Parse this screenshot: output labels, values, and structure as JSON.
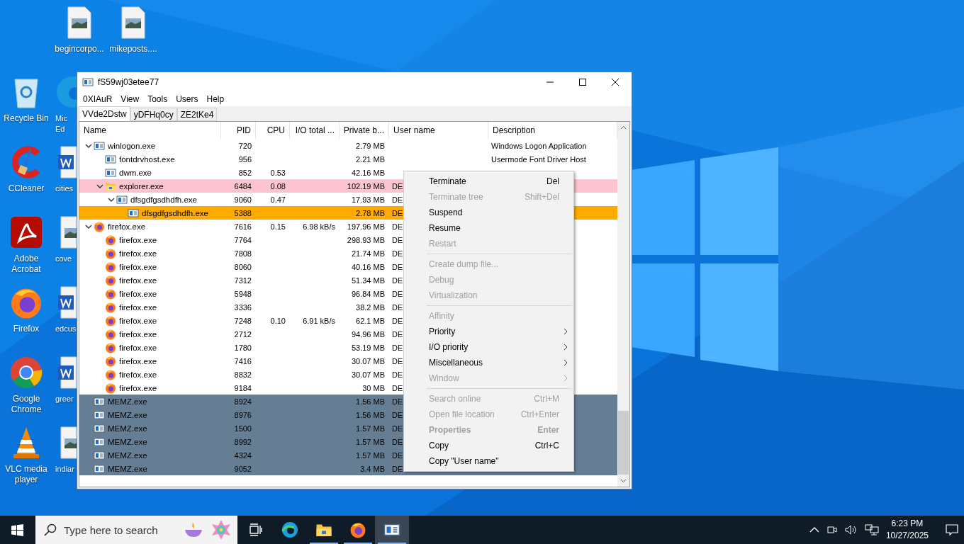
{
  "desktop": {
    "top_row": [
      {
        "label": "begincorpo...",
        "kind": "image-file"
      },
      {
        "label": "mikeposts....",
        "kind": "image-file"
      }
    ],
    "column_1": [
      {
        "label": "Recycle Bin",
        "kind": "recycle-bin"
      },
      {
        "label": "CCleaner",
        "kind": "ccleaner"
      },
      {
        "label": "Adobe Acrobat",
        "kind": "acrobat"
      },
      {
        "label": "Firefox",
        "kind": "firefox"
      },
      {
        "label": "Google Chrome",
        "kind": "chrome"
      },
      {
        "label": "VLC media player",
        "kind": "vlc"
      }
    ],
    "column_2": [
      {
        "label": "Mic Ed",
        "kind": "edge"
      },
      {
        "label": "cities",
        "kind": "word"
      },
      {
        "label": "cove",
        "kind": "image-file"
      },
      {
        "label": "edcus",
        "kind": "word"
      },
      {
        "label": "greer",
        "kind": "word"
      },
      {
        "label": "indiar",
        "kind": "image-file"
      }
    ]
  },
  "window": {
    "title": "fS59wj03etee77",
    "menu": [
      "0XIAuR",
      "View",
      "Tools",
      "Users",
      "Help"
    ],
    "tabs": [
      {
        "label": "VVde2Dstw",
        "selected": true
      },
      {
        "label": "yDFHq0cy",
        "selected": false
      },
      {
        "label": "ZE2tKe4",
        "selected": false
      }
    ],
    "columns": [
      "Name",
      "PID",
      "CPU",
      "I/O total ...",
      "Private b...",
      "User name",
      "Description"
    ],
    "processes": [
      {
        "name": "winlogon.exe",
        "pid": "720",
        "private": "2.79 MB",
        "description": "Windows Logon Application",
        "kind": "app",
        "expanded": true,
        "children": [
          {
            "name": "fontdrvhost.exe",
            "pid": "956",
            "private": "2.21 MB",
            "description": "Usermode Font Driver Host",
            "kind": "app"
          },
          {
            "name": "dwm.exe",
            "pid": "852",
            "cpu": "0.53",
            "private": "42.16 MB",
            "kind": "app"
          },
          {
            "name": "explorer.exe",
            "pid": "6484",
            "cpu": "0.08",
            "private": "102.19 MB",
            "user": "DE",
            "kind": "folder",
            "color": "#fcc4ce",
            "expanded": true,
            "children": [
              {
                "name": "dfsgdfgsdhdfh.exe",
                "pid": "9060",
                "cpu": "0.47",
                "private": "17.93 MB",
                "user": "DE",
                "kind": "app",
                "expanded": true,
                "children": [
                  {
                    "name": "dfsgdfgsdhdfh.exe",
                    "pid": "5388",
                    "private": "2.78 MB",
                    "user": "DE",
                    "kind": "app",
                    "color": "#ffaa00"
                  }
                ]
              }
            ]
          }
        ]
      },
      {
        "name": "firefox.exe",
        "pid": "7616",
        "cpu": "0.15",
        "io": "6.98 kB/s",
        "private": "197.96 MB",
        "user": "DE",
        "kind": "firefox",
        "expanded": true,
        "children": [
          {
            "name": "firefox.exe",
            "pid": "7764",
            "private": "298.93 MB",
            "user": "DE",
            "kind": "firefox"
          },
          {
            "name": "firefox.exe",
            "pid": "7808",
            "private": "21.74 MB",
            "user": "DE",
            "kind": "firefox"
          },
          {
            "name": "firefox.exe",
            "pid": "8060",
            "private": "40.16 MB",
            "user": "DE",
            "kind": "firefox"
          },
          {
            "name": "firefox.exe",
            "pid": "7312",
            "private": "51.34 MB",
            "user": "DE",
            "kind": "firefox"
          },
          {
            "name": "firefox.exe",
            "pid": "5948",
            "private": "96.84 MB",
            "user": "DE",
            "kind": "firefox"
          },
          {
            "name": "firefox.exe",
            "pid": "3336",
            "private": "38.2 MB",
            "user": "DE",
            "kind": "firefox"
          },
          {
            "name": "firefox.exe",
            "pid": "7248",
            "cpu": "0.10",
            "io": "6.91 kB/s",
            "private": "62.1 MB",
            "user": "DE",
            "kind": "firefox"
          },
          {
            "name": "firefox.exe",
            "pid": "2712",
            "private": "94.96 MB",
            "user": "DE",
            "kind": "firefox"
          },
          {
            "name": "firefox.exe",
            "pid": "1780",
            "private": "53.19 MB",
            "user": "DE",
            "kind": "firefox"
          },
          {
            "name": "firefox.exe",
            "pid": "7416",
            "private": "30.07 MB",
            "user": "DE",
            "kind": "firefox"
          },
          {
            "name": "firefox.exe",
            "pid": "8832",
            "private": "30.07 MB",
            "user": "DE",
            "kind": "firefox"
          },
          {
            "name": "firefox.exe",
            "pid": "9184",
            "private": "30 MB",
            "user": "DE",
            "kind": "firefox"
          }
        ]
      },
      {
        "name": "MEMZ.exe",
        "pid": "8924",
        "private": "1.56 MB",
        "user": "DE",
        "kind": "app",
        "color": "#667e94"
      },
      {
        "name": "MEMZ.exe",
        "pid": "8976",
        "private": "1.56 MB",
        "user": "DE",
        "kind": "app",
        "color": "#667e94"
      },
      {
        "name": "MEMZ.exe",
        "pid": "1500",
        "private": "1.57 MB",
        "user": "DE",
        "kind": "app",
        "color": "#667e94"
      },
      {
        "name": "MEMZ.exe",
        "pid": "8992",
        "private": "1.57 MB",
        "user": "DE",
        "kind": "app",
        "color": "#667e94"
      },
      {
        "name": "MEMZ.exe",
        "pid": "4324",
        "private": "1.57 MB",
        "user": "DE",
        "kind": "app",
        "color": "#667e94"
      },
      {
        "name": "MEMZ.exe",
        "pid": "9052",
        "private": "3.4 MB",
        "user": "DE",
        "kind": "app",
        "color": "#667e94"
      }
    ]
  },
  "context_menu": [
    {
      "kind": "item",
      "label": "Terminate",
      "shortcut": "Del",
      "disabled": false
    },
    {
      "kind": "item",
      "label": "Terminate tree",
      "shortcut": "Shift+Del",
      "disabled": true
    },
    {
      "kind": "item",
      "label": "Suspend",
      "disabled": false
    },
    {
      "kind": "item",
      "label": "Resume",
      "disabled": false
    },
    {
      "kind": "item",
      "label": "Restart",
      "disabled": true
    },
    {
      "kind": "separator"
    },
    {
      "kind": "item",
      "label": "Create dump file...",
      "disabled": true
    },
    {
      "kind": "item",
      "label": "Debug",
      "disabled": true
    },
    {
      "kind": "item",
      "label": "Virtualization",
      "disabled": true
    },
    {
      "kind": "separator"
    },
    {
      "kind": "item",
      "label": "Affinity",
      "disabled": true
    },
    {
      "kind": "item",
      "label": "Priority",
      "disabled": false,
      "submenu": true
    },
    {
      "kind": "item",
      "label": "I/O priority",
      "disabled": false,
      "submenu": true
    },
    {
      "kind": "item",
      "label": "Miscellaneous",
      "disabled": false,
      "submenu": true
    },
    {
      "kind": "item",
      "label": "Window",
      "disabled": true,
      "submenu": true
    },
    {
      "kind": "separator"
    },
    {
      "kind": "item",
      "label": "Search online",
      "shortcut": "Ctrl+M",
      "disabled": true
    },
    {
      "kind": "item",
      "label": "Open file location",
      "shortcut": "Ctrl+Enter",
      "disabled": true
    },
    {
      "kind": "item",
      "label": "Properties",
      "shortcut": "Enter",
      "disabled": true,
      "bold": true
    },
    {
      "kind": "item",
      "label": "Copy",
      "shortcut": "Ctrl+C",
      "disabled": false
    },
    {
      "kind": "item",
      "label": "Copy \"User name\"",
      "disabled": false
    }
  ],
  "taskbar": {
    "search_placeholder": "Type here to search",
    "apps": [
      {
        "kind": "edge",
        "running": false,
        "active": false
      },
      {
        "kind": "folder",
        "running": true,
        "active": false
      },
      {
        "kind": "firefox",
        "running": true,
        "active": false
      },
      {
        "kind": "app",
        "running": true,
        "active": true
      }
    ],
    "time": "6:23 PM",
    "date": "10/27/2025"
  }
}
